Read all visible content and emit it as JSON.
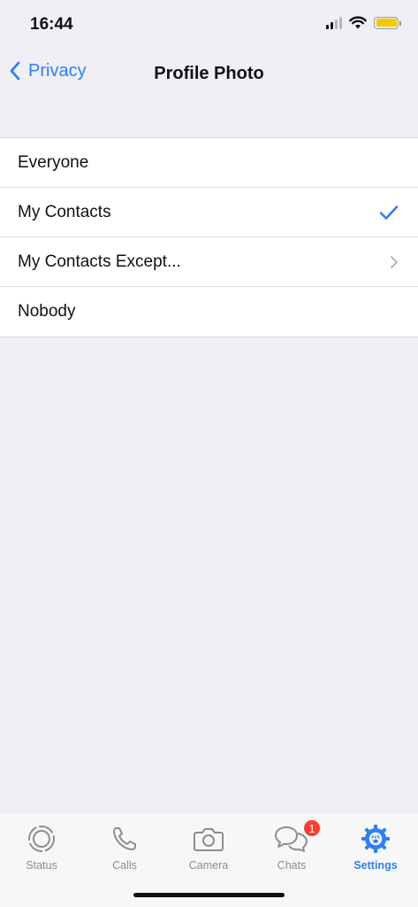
{
  "status_bar": {
    "time": "16:44",
    "icons": [
      "cellular-signal-icon",
      "wifi-icon",
      "battery-icon"
    ],
    "battery_color": "#f5c800"
  },
  "nav": {
    "back_label": "Privacy",
    "title": "Profile Photo"
  },
  "options": [
    {
      "label": "Everyone",
      "accessory": "none"
    },
    {
      "label": "My Contacts",
      "accessory": "checkmark",
      "selected": true
    },
    {
      "label": "My Contacts Except...",
      "accessory": "chevron"
    },
    {
      "label": "Nobody",
      "accessory": "none"
    }
  ],
  "tab_bar": {
    "tabs": [
      {
        "label": "Status",
        "icon": "status-icon"
      },
      {
        "label": "Calls",
        "icon": "phone-icon"
      },
      {
        "label": "Camera",
        "icon": "camera-icon"
      },
      {
        "label": "Chats",
        "icon": "chats-icon",
        "badge": "1"
      },
      {
        "label": "Settings",
        "icon": "settings-gear-icon",
        "active": true
      }
    ]
  },
  "colors": {
    "accent": "#2d7ff9",
    "background": "#f0eff5",
    "badge": "#ff3b30"
  }
}
